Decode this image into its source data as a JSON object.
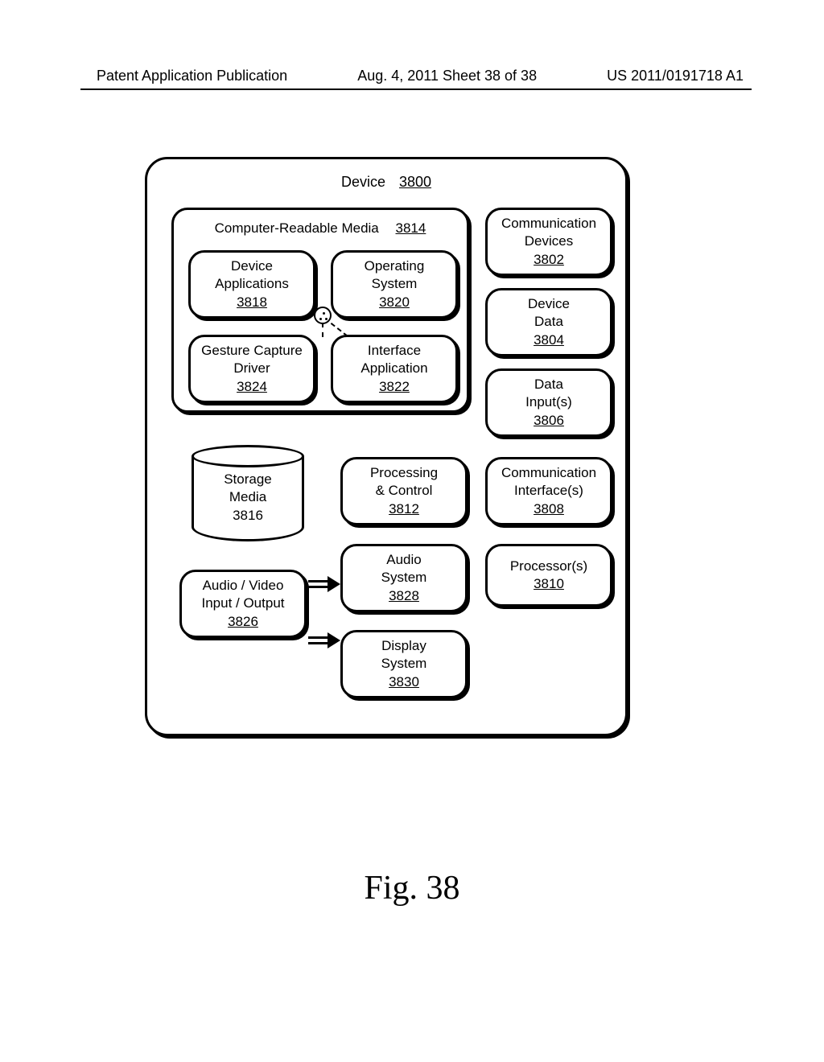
{
  "header": {
    "left": "Patent Application Publication",
    "center": "Aug. 4, 2011  Sheet 38 of 38",
    "right": "US 2011/0191718 A1"
  },
  "device": {
    "label": "Device",
    "ref": "3800"
  },
  "media": {
    "label": "Computer-Readable Media",
    "ref": "3814"
  },
  "blocks": {
    "device_apps": {
      "l1": "Device",
      "l2": "Applications",
      "ref": "3818"
    },
    "os": {
      "l1": "Operating",
      "l2": "System",
      "ref": "3820"
    },
    "gesture": {
      "l1": "Gesture Capture",
      "l2": "Driver",
      "ref": "3824"
    },
    "iface_app": {
      "l1": "Interface",
      "l2": "Application",
      "ref": "3822"
    },
    "comm_dev": {
      "l1": "Communication",
      "l2": "Devices",
      "ref": "3802"
    },
    "dev_data": {
      "l1": "Device",
      "l2": "Data",
      "ref": "3804"
    },
    "data_inputs": {
      "l1": "Data",
      "l2": "Input(s)",
      "ref": "3806"
    },
    "comm_if": {
      "l1": "Communication",
      "l2": "Interface(s)",
      "ref": "3808"
    },
    "processors": {
      "l1": "Processor(s)",
      "ref": "3810"
    },
    "proc_ctrl": {
      "l1": "Processing",
      "l2": "& Control",
      "ref": "3812"
    },
    "audio_sys": {
      "l1": "Audio",
      "l2": "System",
      "ref": "3828"
    },
    "disp_sys": {
      "l1": "Display",
      "l2": "System",
      "ref": "3830"
    },
    "av_io": {
      "l1": "Audio / Video",
      "l2": "Input / Output",
      "ref": "3826"
    },
    "storage": {
      "l1": "Storage",
      "l2": "Media",
      "ref": "3816"
    }
  },
  "caption": "Fig. 38"
}
